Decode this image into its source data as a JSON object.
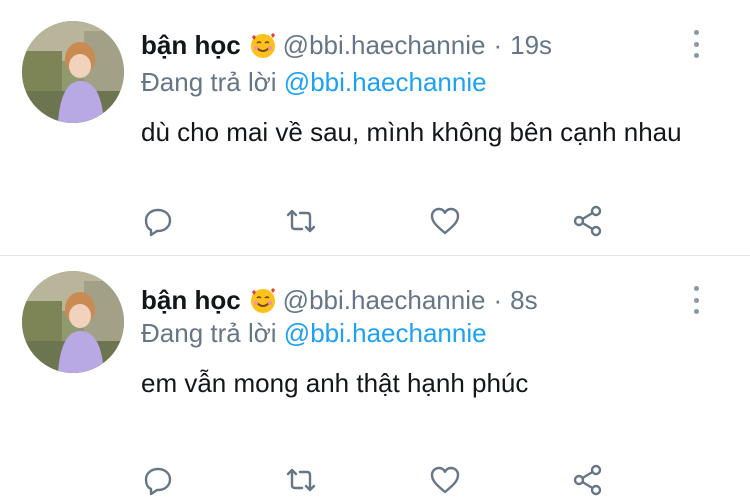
{
  "tweets": [
    {
      "name": "bận học",
      "emoji": "smiling-face-with-hearts-icon",
      "handle": "@bbi.haechannie",
      "separator": "·",
      "time": "19s",
      "reply_prefix": "Đang trả lời",
      "reply_handle": "@bbi.haechannie",
      "text": "dù cho mai về sau, mình không bên cạnh nhau",
      "icons": [
        "reply-icon",
        "retweet-icon",
        "like-icon",
        "share-icon",
        "more-icon"
      ]
    },
    {
      "name": "bận học",
      "emoji": "smiling-face-with-hearts-icon",
      "handle": "@bbi.haechannie",
      "separator": "·",
      "time": "8s",
      "reply_prefix": "Đang trả lời",
      "reply_handle": "@bbi.haechannie",
      "text": "em vẫn mong anh thật hạnh phúc",
      "icons": [
        "reply-icon",
        "retweet-icon",
        "like-icon",
        "share-icon",
        "more-icon"
      ]
    }
  ],
  "colors": {
    "primary_text": "#14171a",
    "secondary_text": "#657786",
    "link": "#1da1f2",
    "icon": "#657786",
    "divider": "#e1e8ed"
  }
}
